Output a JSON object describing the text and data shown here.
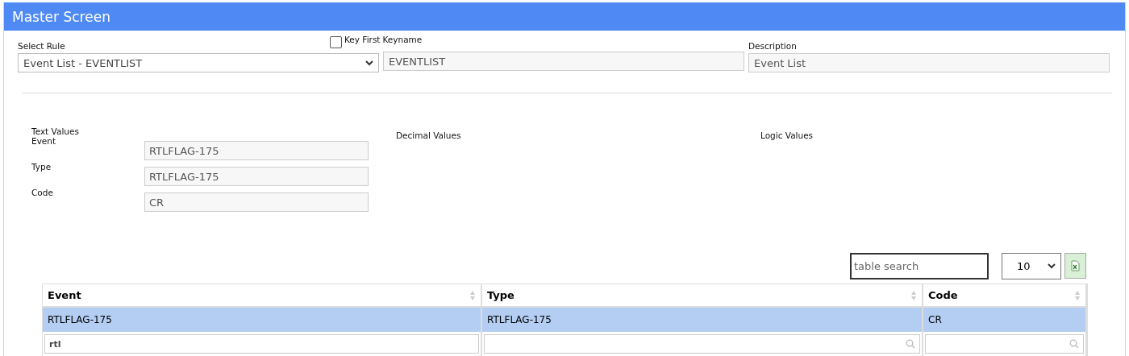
{
  "window": {
    "title": "Master Screen"
  },
  "rule": {
    "label": "Select Rule",
    "value": "Event List - EVENTLIST"
  },
  "key_first": {
    "label": "Key First",
    "checked": false
  },
  "keyname": {
    "label": "Keyname",
    "value": "EVENTLIST"
  },
  "description": {
    "label": "Description",
    "value": "Event List"
  },
  "sections": {
    "text": "Text Values",
    "decimal": "Decimal Values",
    "logic": "Logic Values"
  },
  "text_values": [
    {
      "label": "Event",
      "value": "RTLFLAG-175"
    },
    {
      "label": "Type",
      "value": "RTLFLAG-175"
    },
    {
      "label": "Code",
      "value": "CR"
    }
  ],
  "table_search": {
    "placeholder": "table search"
  },
  "page_size": "10",
  "table": {
    "columns": [
      {
        "label": "Event",
        "filter": "rtl"
      },
      {
        "label": "Type"
      },
      {
        "label": "Code"
      }
    ],
    "rows": [
      {
        "cells": [
          "RTLFLAG-175",
          "RTLFLAG-175",
          "CR"
        ],
        "selected": true
      }
    ]
  }
}
